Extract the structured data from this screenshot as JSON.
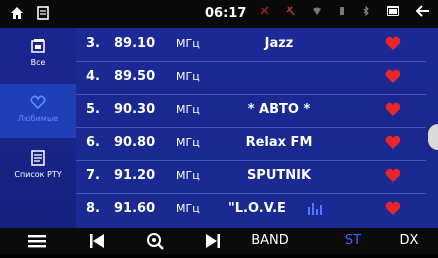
{
  "status_bar": {
    "time": "06:17",
    "icons": [
      "home-icon",
      "recents-icon",
      "camera-icon",
      "satellite-icon",
      "wifi-icon",
      "battery-icon",
      "bluetooth-icon",
      "window-icon",
      "back-icon"
    ]
  },
  "sidebar": {
    "items": [
      {
        "label": "Все",
        "icon": "all-stations-icon",
        "active": false
      },
      {
        "label": "Любимые",
        "icon": "favorites-heart-icon",
        "active": true
      },
      {
        "label": "Список PTY",
        "icon": "pty-list-icon",
        "active": false
      }
    ]
  },
  "stations": [
    {
      "num": "3.",
      "freq": "89.10",
      "unit": "МГц",
      "name": "Jazz",
      "favorite": true,
      "playing": false
    },
    {
      "num": "4.",
      "freq": "89.50",
      "unit": "МГц",
      "name": "",
      "favorite": true,
      "playing": false
    },
    {
      "num": "5.",
      "freq": "90.30",
      "unit": "МГц",
      "name": "* АВТО *",
      "favorite": true,
      "playing": false
    },
    {
      "num": "6.",
      "freq": "90.80",
      "unit": "МГц",
      "name": "Relax FM",
      "favorite": true,
      "playing": false
    },
    {
      "num": "7.",
      "freq": "91.20",
      "unit": "МГц",
      "name": "SPUTNIK",
      "favorite": true,
      "playing": false
    },
    {
      "num": "8.",
      "freq": "91.60",
      "unit": "МГц",
      "name": "\"L.O.V.E",
      "favorite": true,
      "playing": true
    }
  ],
  "bottom_bar": {
    "menu_icon": "menu-icon",
    "prev_icon": "previous-icon",
    "search_icon": "search-icon",
    "next_icon": "next-icon",
    "band_label": "BAND",
    "st_label": "ST",
    "dx_label": "DX"
  },
  "colors": {
    "background": "#1a2890",
    "heart": "#e8262a",
    "active_blue": "#3d64ff",
    "active_sidebar": "#1f3fb6"
  }
}
